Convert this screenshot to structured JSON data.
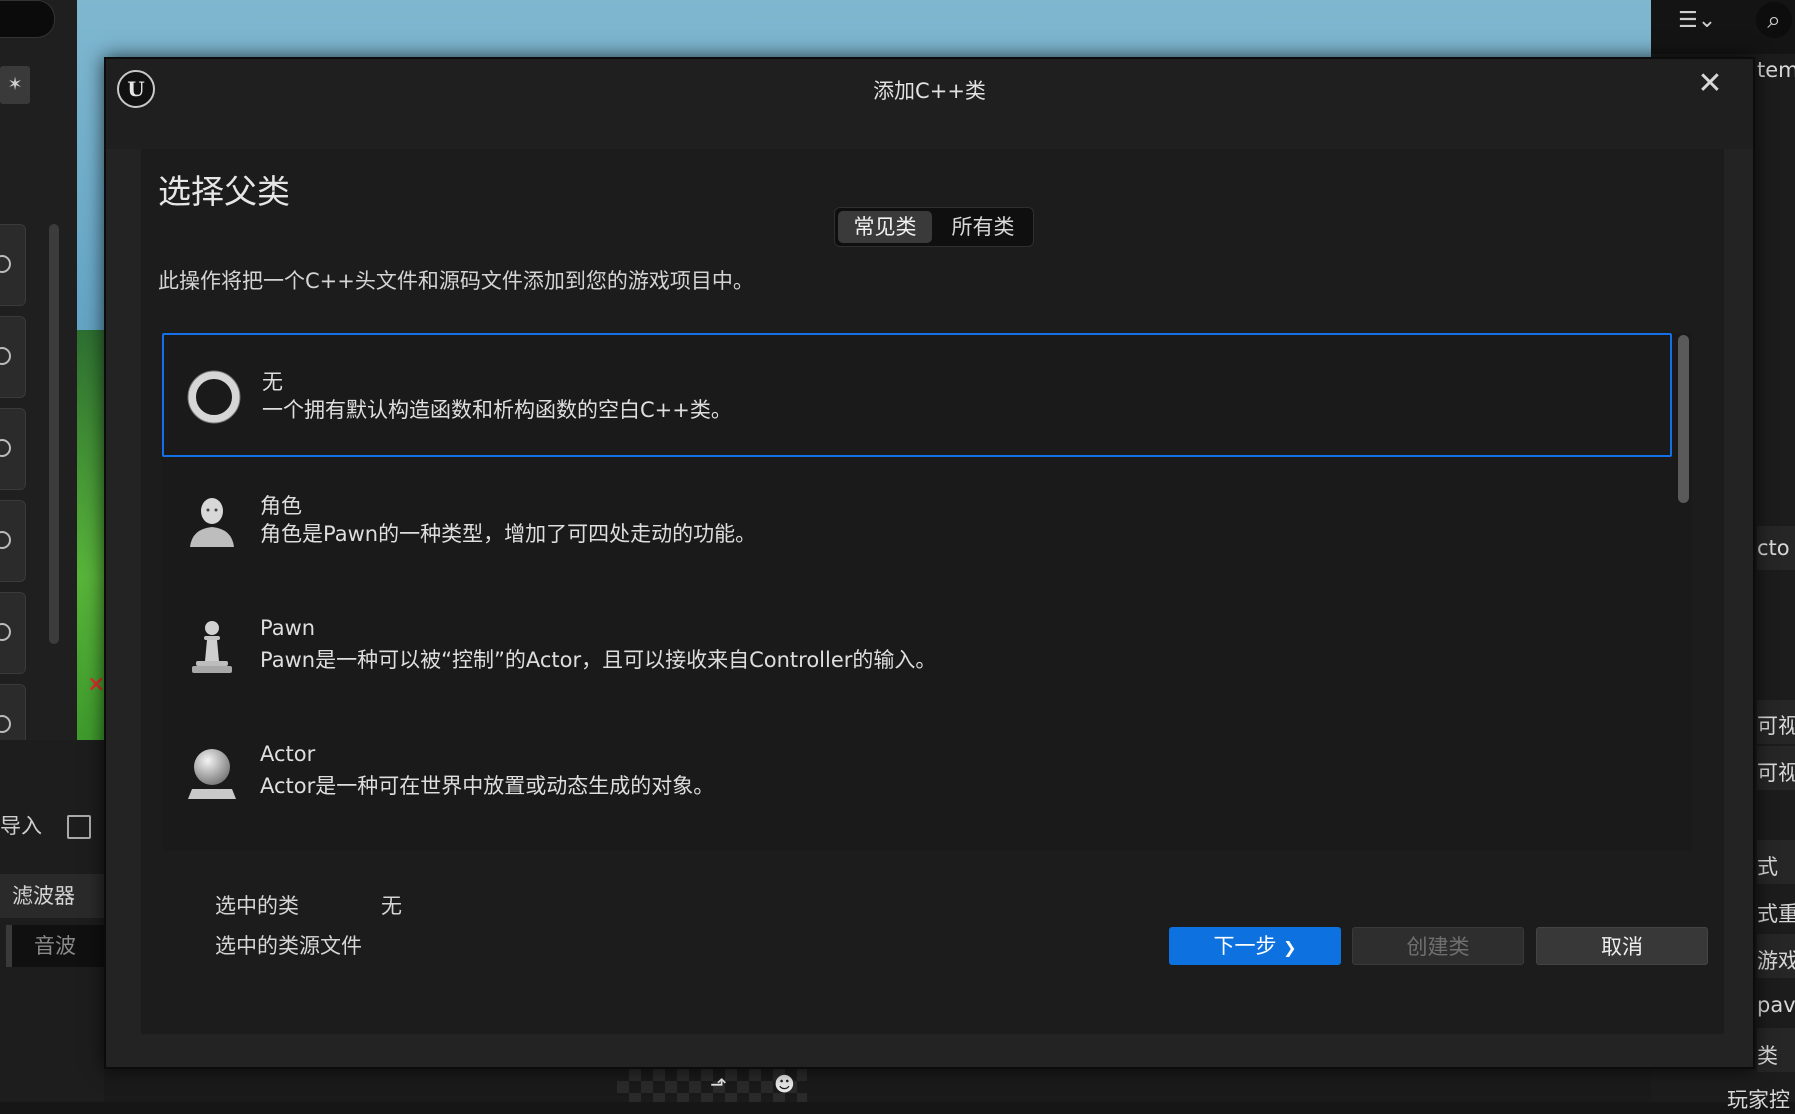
{
  "background": {
    "left_panel": {
      "import_label": "导入",
      "filter_label": "滤波器",
      "sound_label": "音波"
    },
    "right_panel": {
      "snippets": [
        "tem",
        "cto",
        "可视",
        "可视",
        "式",
        "式重",
        "游戏",
        "pav",
        "类",
        "玩家控"
      ]
    }
  },
  "dialog": {
    "title": "添加C++类",
    "logo_text": "U",
    "close_glyph": "✕",
    "heading": "选择父类",
    "tabs": {
      "common": "常见类",
      "all": "所有类"
    },
    "description": "此操作将把一个C++头文件和源码文件添加到您的游戏项目中。",
    "classes": [
      {
        "name": "无",
        "description": "一个拥有默认构造函数和析构函数的空白C++类。",
        "icon": "empty-class-icon",
        "selected": true
      },
      {
        "name": "角色",
        "description": "角色是Pawn的一种类型，增加了可四处走动的功能。",
        "icon": "character-icon",
        "selected": false
      },
      {
        "name": "Pawn",
        "description": "Pawn是一种可以被“控制”的Actor，且可以接收来自Controller的输入。",
        "icon": "pawn-icon",
        "selected": false
      },
      {
        "name": "Actor",
        "description": "Actor是一种可在世界中放置或动态生成的对象。",
        "icon": "actor-icon",
        "selected": false
      }
    ],
    "selected_class_label": "选中的类",
    "selected_class_value": "无",
    "selected_source_label": "选中的类源文件",
    "buttons": {
      "next": "下一步",
      "next_glyph": "❯",
      "create": "创建类",
      "cancel": "取消"
    },
    "accent_color": "#0d72e0"
  }
}
